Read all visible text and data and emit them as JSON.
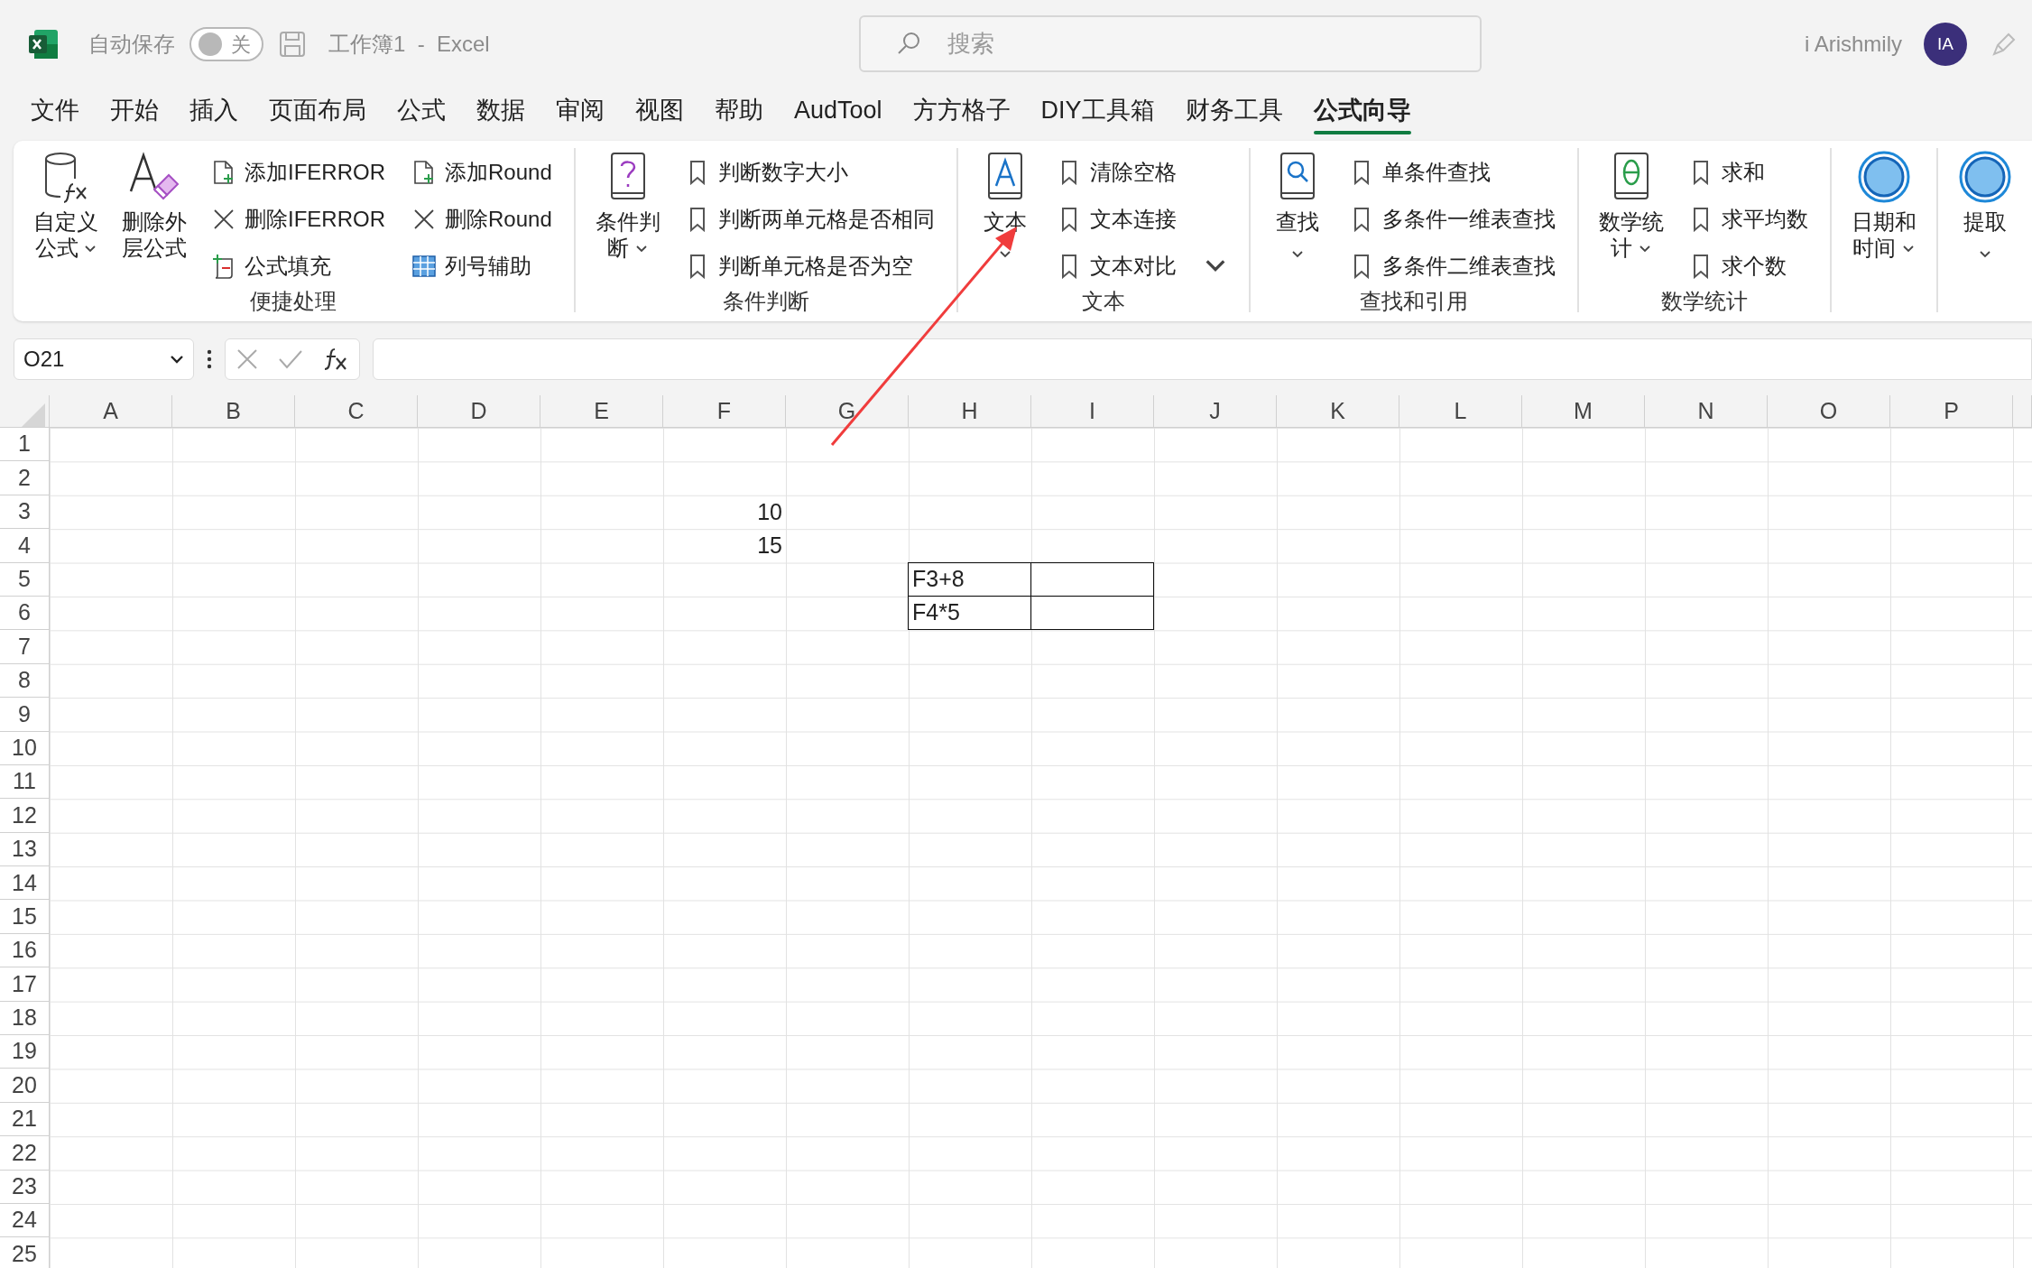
{
  "title_bar": {
    "autosave_label": "自动保存",
    "autosave": {
      "on": false,
      "label": "关"
    },
    "document_title": "工作簿1  -  Excel",
    "search": {
      "placeholder": "搜索"
    },
    "user_name": "i Arishmily",
    "avatar": "IA"
  },
  "menu_tabs": [
    {
      "label": "文件",
      "selected": false
    },
    {
      "label": "开始",
      "selected": false
    },
    {
      "label": "插入",
      "selected": false
    },
    {
      "label": "页面布局",
      "selected": false
    },
    {
      "label": "公式",
      "selected": false
    },
    {
      "label": "数据",
      "selected": false
    },
    {
      "label": "审阅",
      "selected": false
    },
    {
      "label": "视图",
      "selected": false
    },
    {
      "label": "帮助",
      "selected": false
    },
    {
      "label": "AudTool",
      "selected": false
    },
    {
      "label": "方方格子",
      "selected": false
    },
    {
      "label": "DIY工具箱",
      "selected": false
    },
    {
      "label": "财务工具",
      "selected": false
    },
    {
      "label": "公式向导",
      "selected": true
    }
  ],
  "ribbon_groups": [
    {
      "name": "便捷处理",
      "large_buttons": [
        {
          "kind": "cylinder-fx",
          "lines": [
            "自定义",
            "公式"
          ],
          "dropdown": true
        },
        {
          "kind": "letter-eraser",
          "lines": [
            "删除外",
            "层公式"
          ],
          "dropdown": false
        }
      ],
      "small_items": [
        {
          "kind": "doc-add",
          "label": "添加IFERROR",
          "dropdown": false
        },
        {
          "kind": "cross",
          "label": "删除IFERROR",
          "dropdown": false
        },
        {
          "kind": "scroll",
          "label": "公式填充",
          "dropdown": false
        },
        {
          "kind": "doc-add",
          "label": "添加Round",
          "dropdown": false
        },
        {
          "kind": "cross",
          "label": "删除Round",
          "dropdown": false
        },
        {
          "kind": "grid",
          "label": "列号辅助",
          "dropdown": false
        }
      ]
    },
    {
      "name": "条件判断",
      "large_buttons": [
        {
          "kind": "book-question",
          "lines": [
            "条件判",
            "断"
          ],
          "dropdown": true
        }
      ],
      "small_items": [
        {
          "kind": "bookmark",
          "label": "判断数字大小",
          "dropdown": false
        },
        {
          "kind": "bookmark",
          "label": "判断两单元格是否相同",
          "dropdown": false
        },
        {
          "kind": "bookmark",
          "label": "判断单元格是否为空",
          "dropdown": false
        }
      ]
    },
    {
      "name": "文本",
      "large_buttons": [
        {
          "kind": "book-letter",
          "lines": [
            "文本"
          ],
          "dropdown": true
        }
      ],
      "small_items": [
        {
          "kind": "bookmark",
          "label": "清除空格",
          "dropdown": false
        },
        {
          "kind": "bookmark",
          "label": "文本连接",
          "dropdown": false
        },
        {
          "kind": "bookmark",
          "label": "文本对比",
          "dropdown": true
        }
      ]
    },
    {
      "name": "查找和引用",
      "large_buttons": [
        {
          "kind": "book-search",
          "lines": [
            "查找"
          ],
          "dropdown": true
        }
      ],
      "small_items": [
        {
          "kind": "bookmark",
          "label": "单条件查找",
          "dropdown": false
        },
        {
          "kind": "bookmark",
          "label": "多条件一维表查找",
          "dropdown": false
        },
        {
          "kind": "bookmark",
          "label": "多条件二维表查找",
          "dropdown": false
        }
      ]
    },
    {
      "name": "数学统计",
      "large_buttons": [
        {
          "kind": "book-theta",
          "lines": [
            "数学统",
            "计"
          ],
          "dropdown": true
        }
      ],
      "small_items": [
        {
          "kind": "bookmark",
          "label": "求和",
          "dropdown": false
        },
        {
          "kind": "bookmark",
          "label": "求平均数",
          "dropdown": false
        },
        {
          "kind": "bookmark",
          "label": "求个数",
          "dropdown": false
        }
      ]
    },
    {
      "large_buttons": [
        {
          "kind": "circle",
          "lines": [
            "日期和",
            "时间"
          ],
          "dropdown": true
        }
      ]
    },
    {
      "large_buttons": [
        {
          "kind": "circle",
          "lines": [
            "提取"
          ],
          "dropdown": true
        }
      ]
    }
  ],
  "formula_bar": {
    "name_box": "O21"
  },
  "sheet": {
    "columns": [
      "A",
      "B",
      "C",
      "D",
      "E",
      "F",
      "G",
      "H",
      "I",
      "J",
      "K",
      "L",
      "M",
      "N",
      "O",
      "P"
    ],
    "rows": [
      {
        "label": "1"
      },
      {
        "label": "2"
      },
      {
        "label": "3",
        "cells": [
          null,
          null,
          null,
          null,
          null,
          {
            "kind": "number",
            "value": "10",
            "bordered": false
          }
        ]
      },
      {
        "label": "4",
        "cells": [
          null,
          null,
          null,
          null,
          null,
          {
            "kind": "number",
            "value": "15",
            "bordered": false
          }
        ]
      },
      {
        "label": "5",
        "cells": [
          null,
          null,
          null,
          null,
          null,
          null,
          null,
          {
            "kind": "text",
            "value": "F3+8",
            "bordered": true
          },
          {
            "kind": "text",
            "bordered": true
          }
        ]
      },
      {
        "label": "6",
        "cells": [
          null,
          null,
          null,
          null,
          null,
          null,
          null,
          {
            "kind": "text",
            "value": "F4*5",
            "bordered": true
          },
          {
            "kind": "text",
            "bordered": true
          }
        ]
      },
      {
        "label": "7"
      },
      {
        "label": "8"
      },
      {
        "label": "9"
      },
      {
        "label": "10"
      },
      {
        "label": "11"
      },
      {
        "label": "12"
      },
      {
        "label": "13"
      },
      {
        "label": "14"
      },
      {
        "label": "15"
      },
      {
        "label": "16"
      },
      {
        "label": "17"
      },
      {
        "label": "18"
      },
      {
        "label": "19"
      },
      {
        "label": "20"
      },
      {
        "label": "21"
      },
      {
        "label": "22"
      },
      {
        "label": "23"
      },
      {
        "label": "24"
      },
      {
        "label": "25"
      }
    ]
  },
  "annotations": [
    {
      "kind": "arrow",
      "color": "#f03c3c"
    }
  ]
}
